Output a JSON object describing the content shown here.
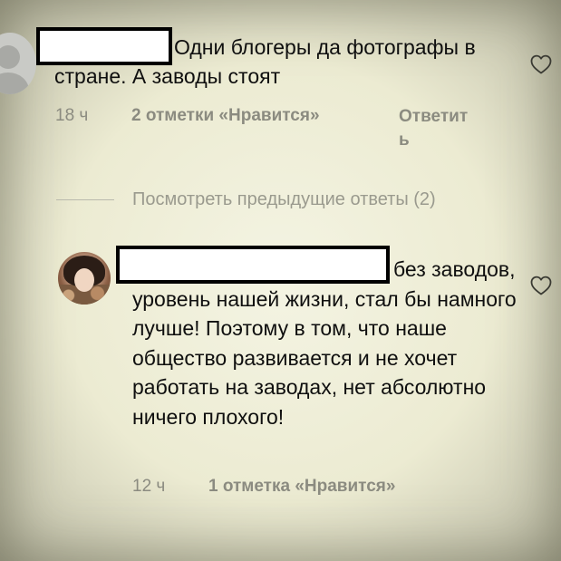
{
  "comments": [
    {
      "username": "",
      "text": "Одни блогеры да фотографы в стране. А заводы стоят",
      "time": "18 ч",
      "likes": "2 отметки «Нравится»",
      "reply_label": "Ответить",
      "avatar_icon": "default-profile-icon",
      "like_icon": "heart-outline-icon"
    },
    {
      "username": "",
      "text": "без заводов, уровень нашей жизни, стал бы намного лучше! Поэтому в том, что наше общество развивается и не хочет работать на заводах, нет абсолютно ничего плохого!",
      "time": "12 ч",
      "likes": "1 отметка «Нравится»",
      "avatar_icon": "profile-photo",
      "like_icon": "heart-outline-icon"
    }
  ],
  "view_previous_replies": "Посмотреть предыдущие ответы (2)",
  "colors": {
    "background": "#f0efdb",
    "text": "#0f0f0f",
    "meta_text": "#8b8b80",
    "muted_link": "#9a9a8e"
  }
}
